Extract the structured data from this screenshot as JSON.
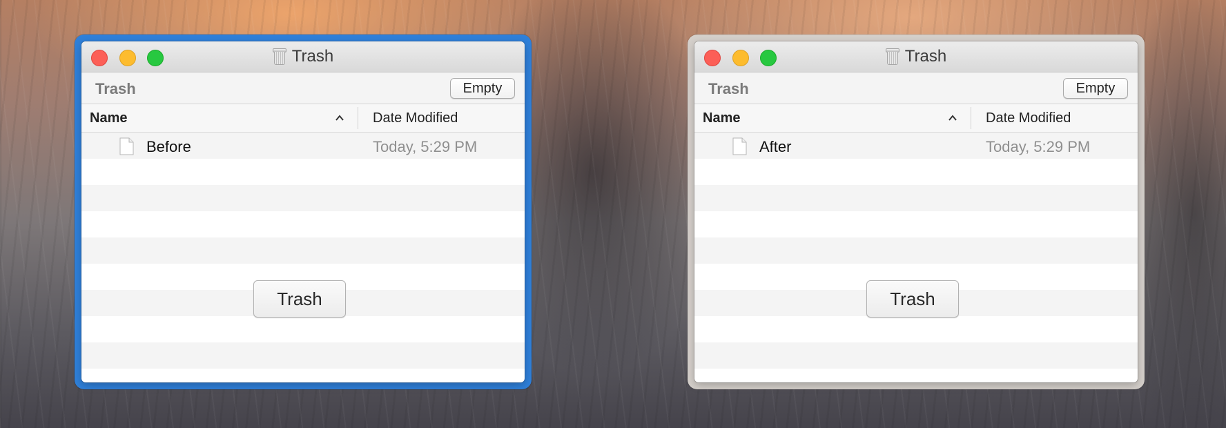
{
  "windows": [
    {
      "title": "Trash",
      "location_label": "Trash",
      "empty_button": "Empty",
      "columns": {
        "name": "Name",
        "date_modified": "Date Modified"
      },
      "rows": [
        {
          "name": "Before",
          "date": "Today, 5:29 PM"
        }
      ],
      "overlay_button": "Trash",
      "focus_ring_color": "#2f80da"
    },
    {
      "title": "Trash",
      "location_label": "Trash",
      "empty_button": "Empty",
      "columns": {
        "name": "Name",
        "date_modified": "Date Modified"
      },
      "rows": [
        {
          "name": "After",
          "date": "Today, 5:29 PM"
        }
      ],
      "overlay_button": "Trash",
      "focus_ring_color": "#d5d0cb"
    }
  ],
  "icons": {
    "window_icon": "trash-can-icon",
    "sort_indicator": "chevron-up-icon",
    "file_icon": "document-icon"
  },
  "colors": {
    "close": "#fc5f57",
    "minimize": "#fdbc2e",
    "zoom": "#27c840"
  }
}
